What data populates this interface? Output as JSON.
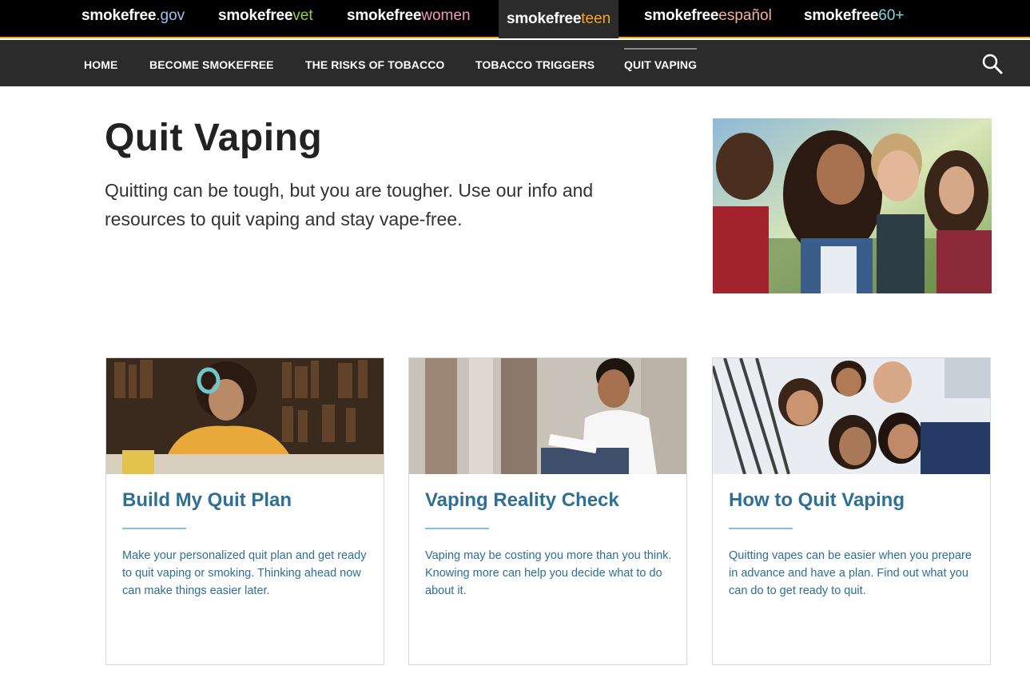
{
  "network": {
    "sites": [
      {
        "prefix": "smokefree",
        "suffix": ".gov"
      },
      {
        "prefix": "smokefree",
        "suffix": "vet"
      },
      {
        "prefix": "smokefree",
        "suffix": "women"
      },
      {
        "prefix": "smokefree",
        "suffix": "teen"
      },
      {
        "prefix": "smokefree",
        "suffix": "español"
      },
      {
        "prefix": "smokefree",
        "suffix": "60+"
      }
    ],
    "active": "smokefreeteen",
    "accent_color": "#f5a623"
  },
  "nav": {
    "items": [
      "HOME",
      "BECOME SMOKEFREE",
      "THE RISKS OF TOBACCO",
      "TOBACCO TRIGGERS",
      "QUIT VAPING"
    ],
    "active": "QUIT VAPING",
    "search_icon": "search-icon"
  },
  "hero": {
    "title": "Quit Vaping",
    "text": "Quitting can be tough, but you are tougher. Use our info and resources to quit vaping and stay vape-free."
  },
  "cards": [
    {
      "title": "Build My Quit Plan",
      "description": "Make your personalized quit plan and get ready to quit vaping or smoking. Thinking ahead now can make things easier later."
    },
    {
      "title": "Vaping Reality Check",
      "description": "Vaping may be costing you more than you think. Knowing more can help you decide what to do about it."
    },
    {
      "title": "How to Quit Vaping",
      "description": "Quitting vapes can be easier when you prepare in advance and have a plan. Find out what you can do to get ready to quit."
    }
  ]
}
